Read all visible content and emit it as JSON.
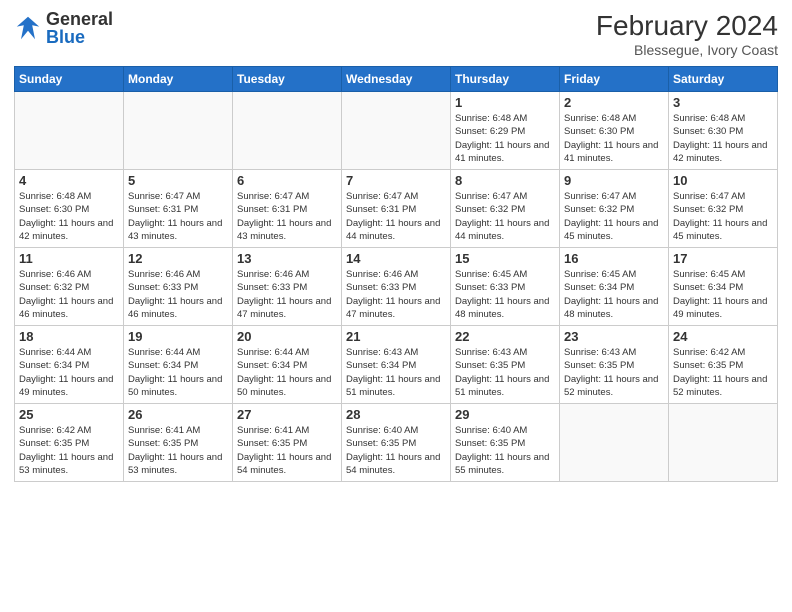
{
  "header": {
    "logo_general": "General",
    "logo_blue": "Blue",
    "month_year": "February 2024",
    "location": "Blessegue, Ivory Coast"
  },
  "days_of_week": [
    "Sunday",
    "Monday",
    "Tuesday",
    "Wednesday",
    "Thursday",
    "Friday",
    "Saturday"
  ],
  "weeks": [
    [
      {
        "num": "",
        "info": ""
      },
      {
        "num": "",
        "info": ""
      },
      {
        "num": "",
        "info": ""
      },
      {
        "num": "",
        "info": ""
      },
      {
        "num": "1",
        "info": "Sunrise: 6:48 AM\nSunset: 6:29 PM\nDaylight: 11 hours and 41 minutes."
      },
      {
        "num": "2",
        "info": "Sunrise: 6:48 AM\nSunset: 6:30 PM\nDaylight: 11 hours and 41 minutes."
      },
      {
        "num": "3",
        "info": "Sunrise: 6:48 AM\nSunset: 6:30 PM\nDaylight: 11 hours and 42 minutes."
      }
    ],
    [
      {
        "num": "4",
        "info": "Sunrise: 6:48 AM\nSunset: 6:30 PM\nDaylight: 11 hours and 42 minutes."
      },
      {
        "num": "5",
        "info": "Sunrise: 6:47 AM\nSunset: 6:31 PM\nDaylight: 11 hours and 43 minutes."
      },
      {
        "num": "6",
        "info": "Sunrise: 6:47 AM\nSunset: 6:31 PM\nDaylight: 11 hours and 43 minutes."
      },
      {
        "num": "7",
        "info": "Sunrise: 6:47 AM\nSunset: 6:31 PM\nDaylight: 11 hours and 44 minutes."
      },
      {
        "num": "8",
        "info": "Sunrise: 6:47 AM\nSunset: 6:32 PM\nDaylight: 11 hours and 44 minutes."
      },
      {
        "num": "9",
        "info": "Sunrise: 6:47 AM\nSunset: 6:32 PM\nDaylight: 11 hours and 45 minutes."
      },
      {
        "num": "10",
        "info": "Sunrise: 6:47 AM\nSunset: 6:32 PM\nDaylight: 11 hours and 45 minutes."
      }
    ],
    [
      {
        "num": "11",
        "info": "Sunrise: 6:46 AM\nSunset: 6:32 PM\nDaylight: 11 hours and 46 minutes."
      },
      {
        "num": "12",
        "info": "Sunrise: 6:46 AM\nSunset: 6:33 PM\nDaylight: 11 hours and 46 minutes."
      },
      {
        "num": "13",
        "info": "Sunrise: 6:46 AM\nSunset: 6:33 PM\nDaylight: 11 hours and 47 minutes."
      },
      {
        "num": "14",
        "info": "Sunrise: 6:46 AM\nSunset: 6:33 PM\nDaylight: 11 hours and 47 minutes."
      },
      {
        "num": "15",
        "info": "Sunrise: 6:45 AM\nSunset: 6:33 PM\nDaylight: 11 hours and 48 minutes."
      },
      {
        "num": "16",
        "info": "Sunrise: 6:45 AM\nSunset: 6:34 PM\nDaylight: 11 hours and 48 minutes."
      },
      {
        "num": "17",
        "info": "Sunrise: 6:45 AM\nSunset: 6:34 PM\nDaylight: 11 hours and 49 minutes."
      }
    ],
    [
      {
        "num": "18",
        "info": "Sunrise: 6:44 AM\nSunset: 6:34 PM\nDaylight: 11 hours and 49 minutes."
      },
      {
        "num": "19",
        "info": "Sunrise: 6:44 AM\nSunset: 6:34 PM\nDaylight: 11 hours and 50 minutes."
      },
      {
        "num": "20",
        "info": "Sunrise: 6:44 AM\nSunset: 6:34 PM\nDaylight: 11 hours and 50 minutes."
      },
      {
        "num": "21",
        "info": "Sunrise: 6:43 AM\nSunset: 6:34 PM\nDaylight: 11 hours and 51 minutes."
      },
      {
        "num": "22",
        "info": "Sunrise: 6:43 AM\nSunset: 6:35 PM\nDaylight: 11 hours and 51 minutes."
      },
      {
        "num": "23",
        "info": "Sunrise: 6:43 AM\nSunset: 6:35 PM\nDaylight: 11 hours and 52 minutes."
      },
      {
        "num": "24",
        "info": "Sunrise: 6:42 AM\nSunset: 6:35 PM\nDaylight: 11 hours and 52 minutes."
      }
    ],
    [
      {
        "num": "25",
        "info": "Sunrise: 6:42 AM\nSunset: 6:35 PM\nDaylight: 11 hours and 53 minutes."
      },
      {
        "num": "26",
        "info": "Sunrise: 6:41 AM\nSunset: 6:35 PM\nDaylight: 11 hours and 53 minutes."
      },
      {
        "num": "27",
        "info": "Sunrise: 6:41 AM\nSunset: 6:35 PM\nDaylight: 11 hours and 54 minutes."
      },
      {
        "num": "28",
        "info": "Sunrise: 6:40 AM\nSunset: 6:35 PM\nDaylight: 11 hours and 54 minutes."
      },
      {
        "num": "29",
        "info": "Sunrise: 6:40 AM\nSunset: 6:35 PM\nDaylight: 11 hours and 55 minutes."
      },
      {
        "num": "",
        "info": ""
      },
      {
        "num": "",
        "info": ""
      }
    ]
  ]
}
